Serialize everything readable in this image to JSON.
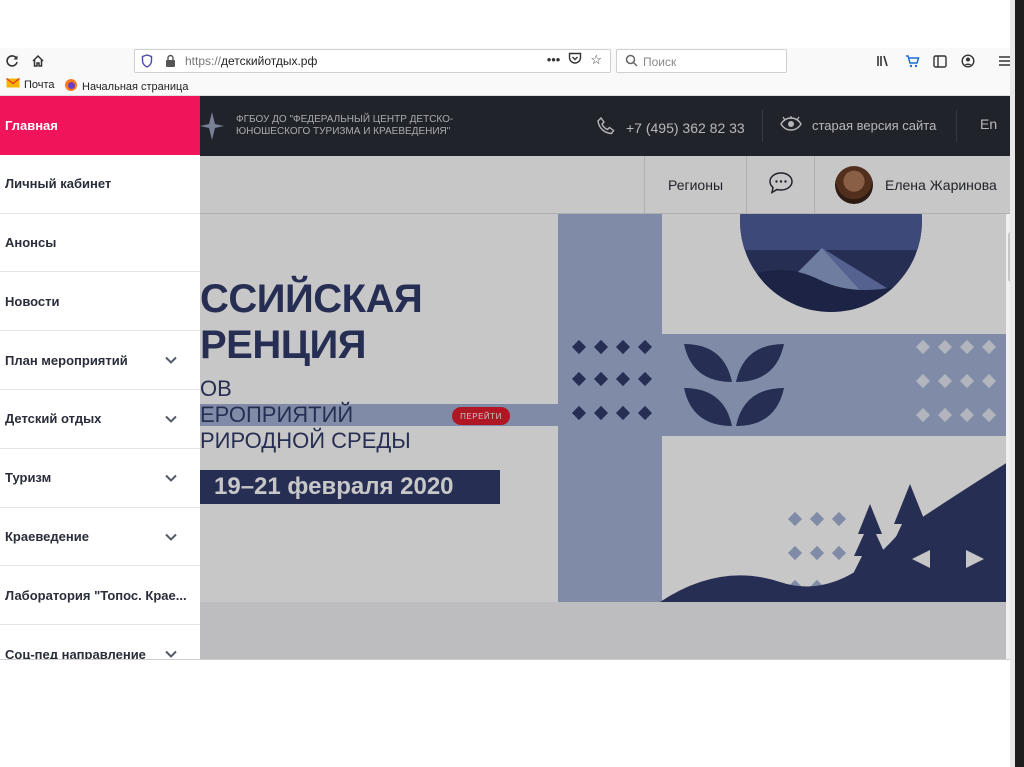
{
  "browser": {
    "url_proto": "https://",
    "url_host": "детскийотдых.рф",
    "search_placeholder": "Поиск",
    "bookmarks": [
      "Почта",
      "Начальная страница"
    ]
  },
  "site": {
    "org_name": "ФГБОУ ДО \"ФЕДЕРАЛЬНЫЙ ЦЕНТР ДЕТСКО-ЮНОШЕСКОГО ТУРИЗМА И КРАЕВЕДЕНИЯ\"",
    "phone": "+7 (495) 362 82 33",
    "old_version": "старая версия сайта",
    "lang": "En",
    "regions": "Регионы",
    "user_name": "Елена Жаринова"
  },
  "banner": {
    "title_line1": "ССИЙСКАЯ",
    "title_line2": "РЕНЦИЯ",
    "sub_line1": "ОВ",
    "sub_line2": "ЕРОПРИЯТИЙ",
    "sub_line3": "РИРОДНОЙ СРЕДЫ",
    "go_button": "ПЕРЕЙТИ",
    "date": "19–21 февраля 2020"
  },
  "menu": [
    {
      "label": "Главная",
      "active": true,
      "expandable": false
    },
    {
      "label": "Личный кабинет",
      "expandable": false
    },
    {
      "label": "Анонсы",
      "expandable": false
    },
    {
      "label": "Новости",
      "expandable": false
    },
    {
      "label": "План мероприятий",
      "expandable": true
    },
    {
      "label": "Детский отдых",
      "expandable": true
    },
    {
      "label": "Туризм",
      "expandable": true
    },
    {
      "label": "Краеведение",
      "expandable": true
    },
    {
      "label": "Лаборатория \"Топос. Крае...",
      "expandable": false
    },
    {
      "label": "Соц-пед направление",
      "expandable": true
    }
  ],
  "colors": {
    "accent_pink": "#f0145a",
    "header_dark": "#2b2e36",
    "banner_navy": "#333c6c",
    "banner_blue": "#a4b3d7",
    "go_red": "#e21d2d"
  },
  "icons": [
    "reload-icon",
    "home-icon",
    "shield-icon",
    "lock-icon",
    "more-icon",
    "pocket-icon",
    "star-icon",
    "search-icon",
    "library-icon",
    "cart-icon",
    "sidebar-icon",
    "account-icon",
    "hamburger-icon",
    "mail-icon",
    "firefox-icon",
    "phone-icon",
    "eye-icon",
    "chat-icon",
    "volume-icon",
    "chevron-down-icon",
    "arrow-left-icon",
    "arrow-right-icon"
  ]
}
